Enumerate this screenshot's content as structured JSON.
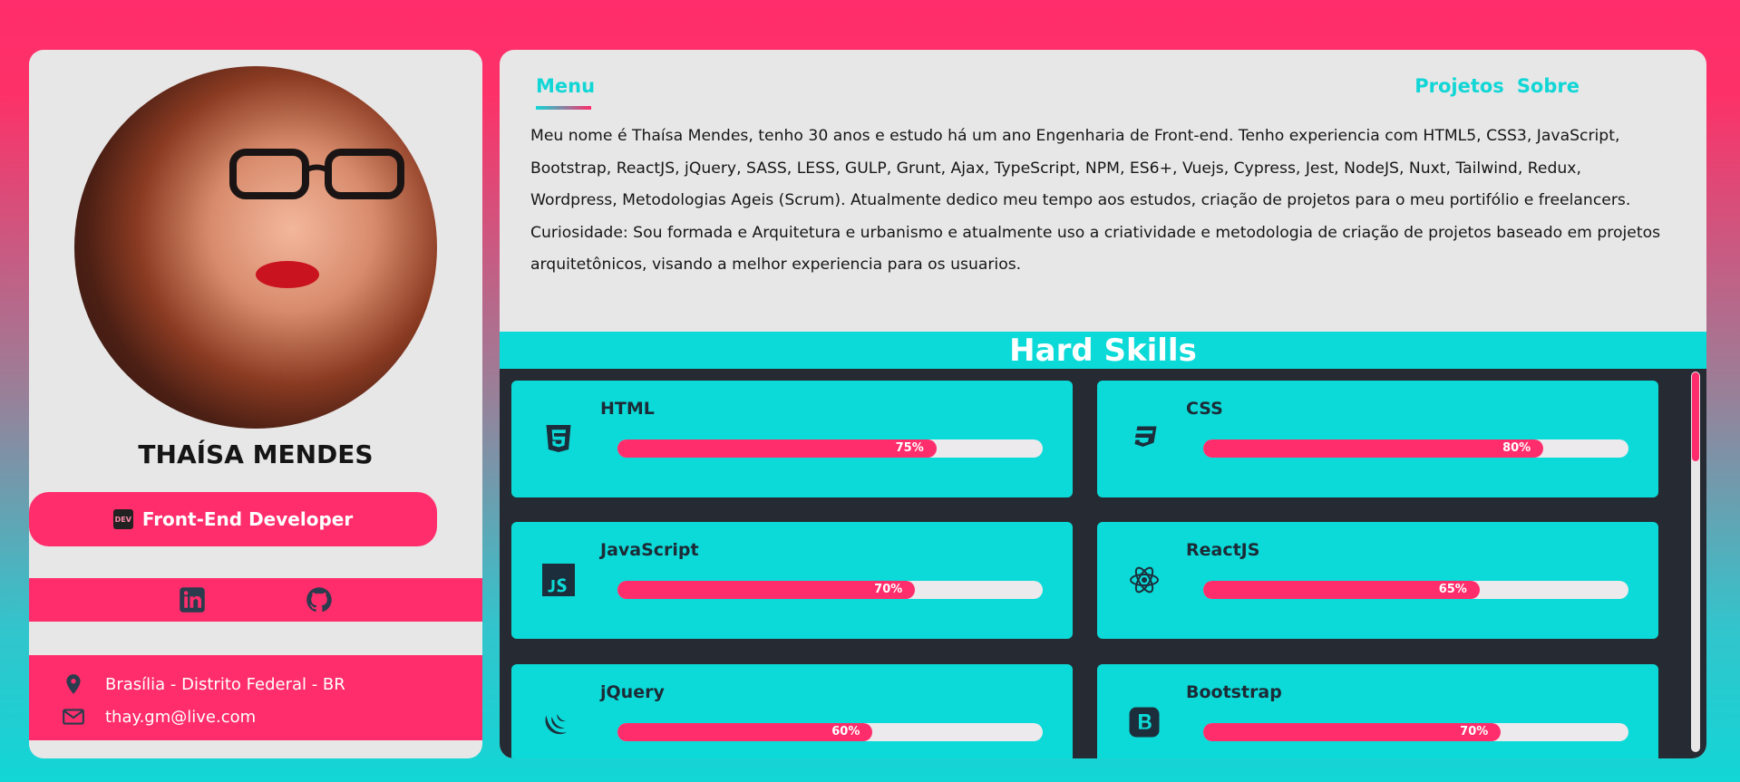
{
  "profile": {
    "name": "THAÍSA MENDES",
    "role": "Front-End Developer",
    "dev_badge": "DEV",
    "location": "Brasília - Distrito Federal - BR",
    "email": "thay.gm@live.com"
  },
  "social": {
    "linkedin_icon": "linkedin-icon",
    "github_icon": "github-icon"
  },
  "nav": {
    "menu": "Menu",
    "projects": "Projetos",
    "about": "Sobre"
  },
  "bio": {
    "paragraph1": "Meu nome é Thaísa Mendes, tenho 30 anos e estudo há um ano Engenharia de Front-end. Tenho experiencia com HTML5, CSS3, JavaScript, Bootstrap, ReactJS, jQuery, SASS, LESS, GULP, Grunt, Ajax, TypeScript, NPM, ES6+, Vuejs, Cypress, Jest, NodeJS, Nuxt, Tailwind, Redux, Wordpress, Metodologias Ageis (Scrum). Atualmente dedico meu tempo aos estudos, criação de projetos para o meu portifólio e freelancers.",
    "paragraph2": "Curiosidade: Sou formada e Arquitetura e urbanismo e atualmente uso a criatividade e metodologia de criação de projetos baseado em projetos arquitetônicos, visando a melhor experiencia para os usuarios."
  },
  "hard_skills": {
    "title": "Hard Skills",
    "items": [
      {
        "name": "HTML",
        "percent": 75,
        "label": "75%",
        "icon": "html5-icon"
      },
      {
        "name": "CSS",
        "percent": 80,
        "label": "80%",
        "icon": "css3-icon"
      },
      {
        "name": "JavaScript",
        "percent": 70,
        "label": "70%",
        "icon": "javascript-icon"
      },
      {
        "name": "ReactJS",
        "percent": 65,
        "label": "65%",
        "icon": "react-icon"
      },
      {
        "name": "jQuery",
        "percent": 60,
        "label": "60%",
        "icon": "jquery-icon"
      },
      {
        "name": "Bootstrap",
        "percent": 70,
        "label": "70%",
        "icon": "bootstrap-icon"
      }
    ]
  },
  "colors": {
    "accent_pink": "#ff2d6b",
    "accent_cyan": "#0cdad8",
    "dark_panel": "#252a33",
    "card_bg": "#e8e7e8"
  }
}
